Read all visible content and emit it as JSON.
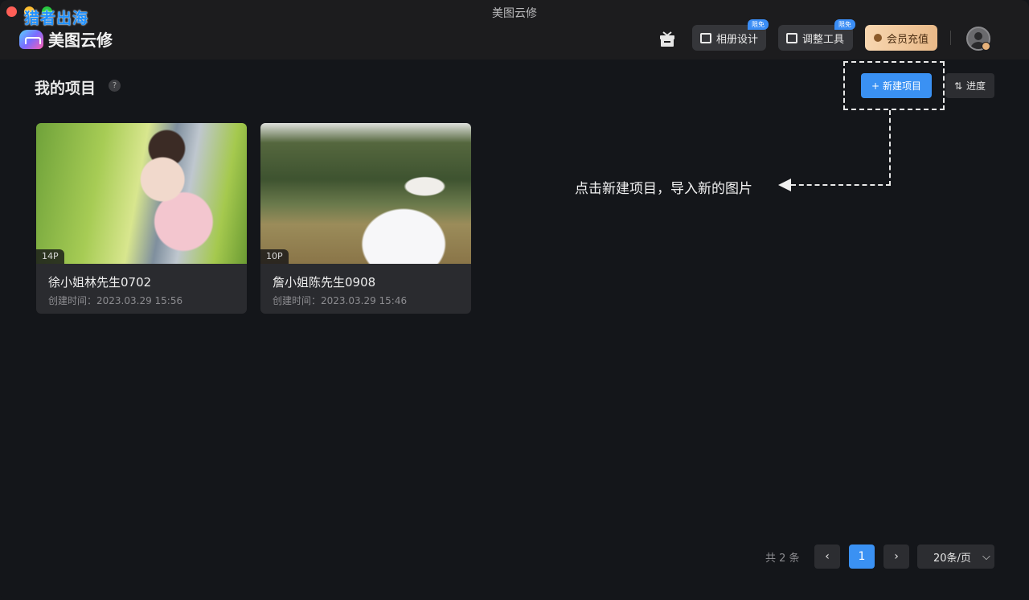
{
  "window": {
    "title": "美图云修",
    "watermark": "猎者出海"
  },
  "header": {
    "logo_text": "美图云修",
    "album_btn": {
      "label": "相册设计",
      "tag": "限免"
    },
    "adjust_btn": {
      "label": "调整工具",
      "tag": "限免"
    },
    "vip_btn": {
      "label": "会员充值"
    }
  },
  "main": {
    "title": "我的项目",
    "help": "?",
    "new_project_label": "新建项目",
    "progress_label": "进度",
    "hint": "点击新建项目，导入新的图片"
  },
  "projects": [
    {
      "name": "徐小姐林先生0702",
      "count": "14P",
      "time": "创建时间：2023.03.29 15:56"
    },
    {
      "name": "詹小姐陈先生0908",
      "count": "10P",
      "time": "创建时间：2023.03.29 15:46"
    }
  ],
  "pagination": {
    "total": "共 2 条",
    "current": "1",
    "page_size": "20条/页"
  },
  "icons": {
    "plus": "+",
    "sort": "⇅",
    "prev": "‹",
    "next": "›",
    "dropdown": "⌵"
  }
}
